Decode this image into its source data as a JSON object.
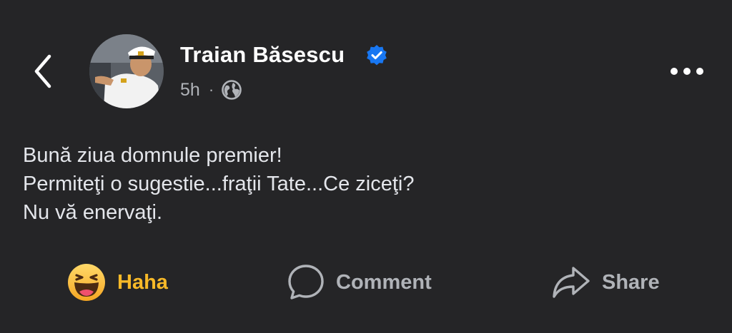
{
  "post": {
    "author": "Traian Băsescu",
    "verified": true,
    "timestamp": "5h",
    "separator": "·",
    "privacy_icon": "globe-icon",
    "lines": [
      "Bună ziua domnule premier!",
      "Permiteţi o sugestie...fraţii Tate...Ce ziceţi?",
      "Nu vă enervaţi."
    ]
  },
  "actions": {
    "haha_label": "Haha",
    "comment_label": "Comment",
    "share_label": "Share"
  },
  "colors": {
    "background": "#252527",
    "verified_blue": "#1877f2",
    "haha_yellow": "#f7b928",
    "secondary_text": "#b0b3b8"
  }
}
